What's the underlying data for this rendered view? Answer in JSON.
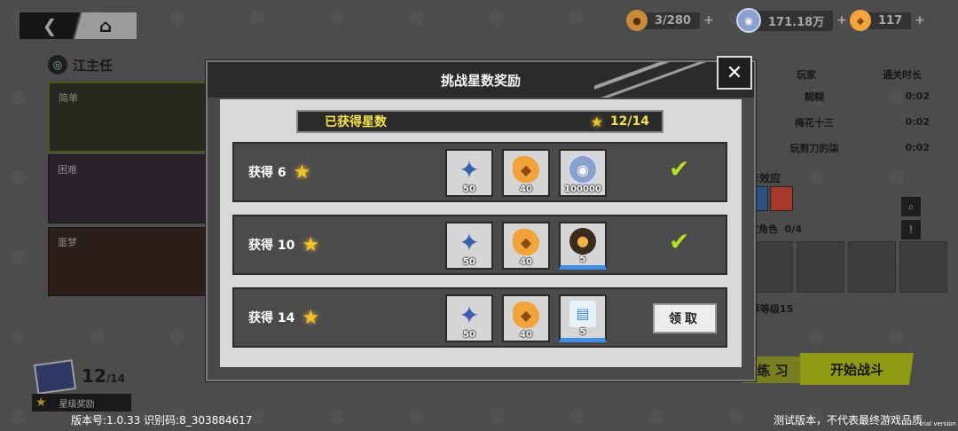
{
  "nav": {
    "back_icon": "chevron-left-icon",
    "home_icon": "home-icon"
  },
  "resources": [
    {
      "name": "stamina",
      "icon": "drumstick-icon",
      "value": "3/280",
      "plus": "+"
    },
    {
      "name": "coins",
      "icon": "coin-icon",
      "value": "171.18万",
      "plus": "+"
    },
    {
      "name": "gems",
      "icon": "fish-icon",
      "value": "117",
      "plus": "+"
    }
  ],
  "stage": {
    "title": "江主任",
    "difficulties": [
      "简单",
      "困难",
      "噩梦"
    ]
  },
  "star_progress": {
    "value": "12",
    "total": "/14",
    "label": "星级奖励"
  },
  "ranking": {
    "headers": [
      "名",
      "玩家",
      "通关时长"
    ],
    "rows": [
      {
        "player": "糊糊",
        "time": "0:02"
      },
      {
        "player": "梅花十三",
        "time": "0:02"
      },
      {
        "player": "玩剪刀的柒",
        "time": "0:02"
      }
    ],
    "effect_label": "卡效应",
    "lock_label": "定角色",
    "lock_count": "0/4",
    "level_text": "荐等级15"
  },
  "buttons": {
    "practice": "练 习",
    "start": "开始战斗"
  },
  "footer": {
    "version": "版本号:1.0.33 识别码:8_303884617",
    "notice": "测试版本，不代表最终游戏品质",
    "trial": "trial version"
  },
  "modal": {
    "title": "挑战星数奖励",
    "close": "✕",
    "stars_label": "已获得星数",
    "stars_value": "12/14",
    "claim_label": "领取",
    "rewards": [
      {
        "label": "获得 6",
        "claimed": true,
        "items": [
          {
            "icon": "shuriken-icon",
            "count": "50",
            "rare": false
          },
          {
            "icon": "fish-icon",
            "count": "40",
            "rare": false
          },
          {
            "icon": "coin-icon",
            "count": "100000",
            "rare": false
          }
        ]
      },
      {
        "label": "获得 10",
        "claimed": true,
        "items": [
          {
            "icon": "shuriken-icon",
            "count": "50",
            "rare": false
          },
          {
            "icon": "fish-icon",
            "count": "40",
            "rare": false
          },
          {
            "icon": "takoyaki-icon",
            "count": "5",
            "rare": true
          }
        ]
      },
      {
        "label": "获得 14",
        "claimed": false,
        "items": [
          {
            "icon": "shuriken-icon",
            "count": "50",
            "rare": false
          },
          {
            "icon": "fish-icon",
            "count": "40",
            "rare": false
          },
          {
            "icon": "book-icon",
            "count": "5",
            "rare": true
          }
        ]
      }
    ]
  }
}
